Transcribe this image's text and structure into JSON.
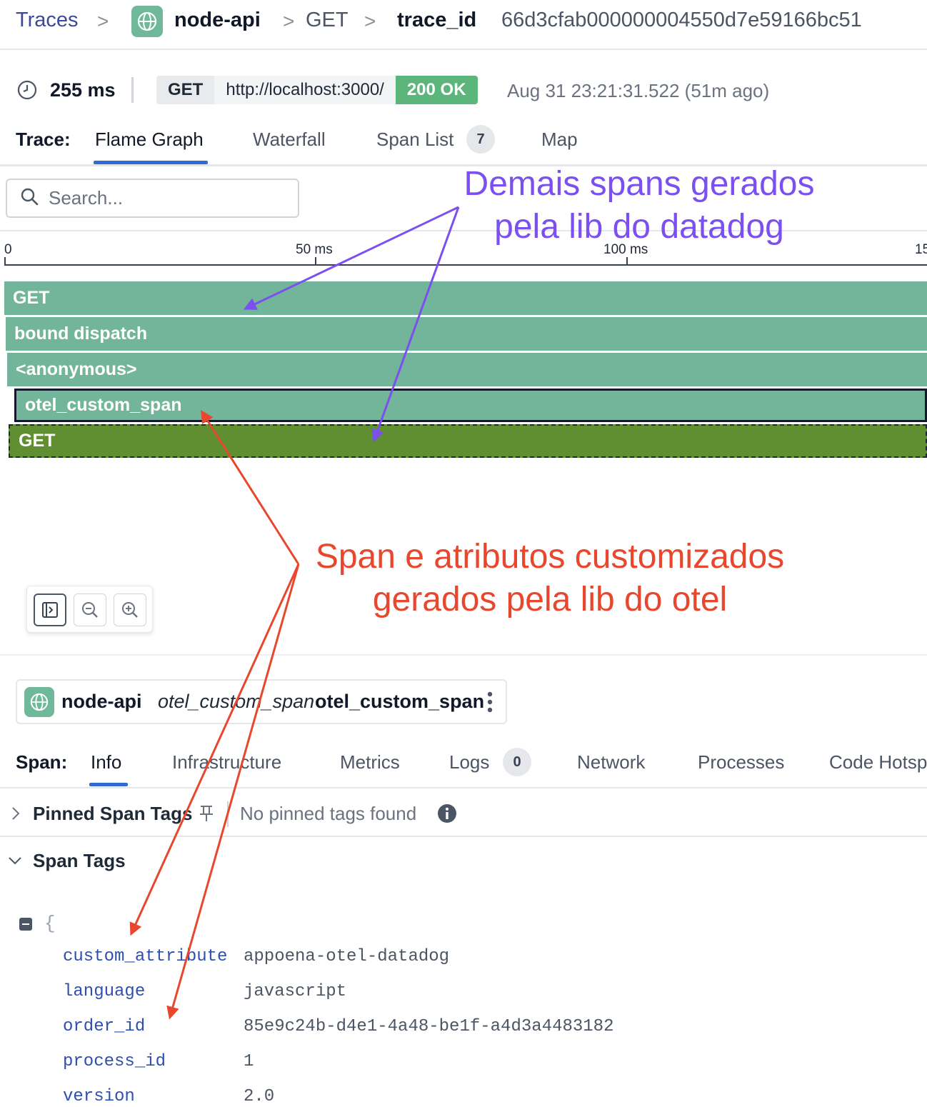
{
  "breadcrumb": {
    "traces": "Traces",
    "service": "node-api",
    "method": "GET",
    "trace_id_label": "trace_id",
    "trace_id": "66d3cfab000000004550d7e59166bc51"
  },
  "meta": {
    "duration": "255 ms",
    "method": "GET",
    "url": "http://localhost:3000/",
    "status": "200 OK",
    "timestamp": "Aug 31 23:21:31.522 (51m ago)"
  },
  "trace_tabs": {
    "label": "Trace:",
    "flame_graph": "Flame Graph",
    "waterfall": "Waterfall",
    "span_list": "Span List",
    "span_list_count": "7",
    "map": "Map"
  },
  "search": {
    "placeholder": "Search..."
  },
  "timeline": {
    "ticks": [
      "0",
      "50 ms",
      "100 ms",
      "15"
    ]
  },
  "spans": [
    "GET",
    "bound dispatch",
    "<anonymous>",
    "otel_custom_span",
    "GET"
  ],
  "span_header": {
    "service": "node-api",
    "resource": "otel_custom_span",
    "name": "otel_custom_span"
  },
  "span_tabs": {
    "label": "Span:",
    "info": "Info",
    "infrastructure": "Infrastructure",
    "metrics": "Metrics",
    "logs": "Logs",
    "logs_count": "0",
    "network": "Network",
    "processes": "Processes",
    "code_hotspots": "Code Hotsp"
  },
  "pinned": {
    "title": "Pinned Span Tags",
    "empty": "No pinned tags found"
  },
  "span_tags": {
    "title": "Span Tags",
    "open_brace": "{",
    "rows": [
      {
        "key": "custom_attribute",
        "value": "appoena-otel-datadog"
      },
      {
        "key": "language",
        "value": "javascript"
      },
      {
        "key": "order_id",
        "value": "85e9c24b-d4e1-4a48-be1f-a4d3a4483182"
      },
      {
        "key": "process_id",
        "value": "1"
      },
      {
        "key": "version",
        "value": "2.0"
      }
    ]
  },
  "annotations": {
    "purple_line1": "Demais spans gerados",
    "purple_line2": "pela lib do datadog",
    "red_line1": "Span e atributos customizados",
    "red_line2": "gerados pela lib do otel"
  },
  "colors": {
    "span_teal": "#72b59a",
    "span_green": "#5f8f31",
    "status_ok": "#5cb57a",
    "annotation_purple": "#7b4ff0",
    "annotation_red": "#e8472e",
    "tab_active": "#2f6bd3"
  }
}
